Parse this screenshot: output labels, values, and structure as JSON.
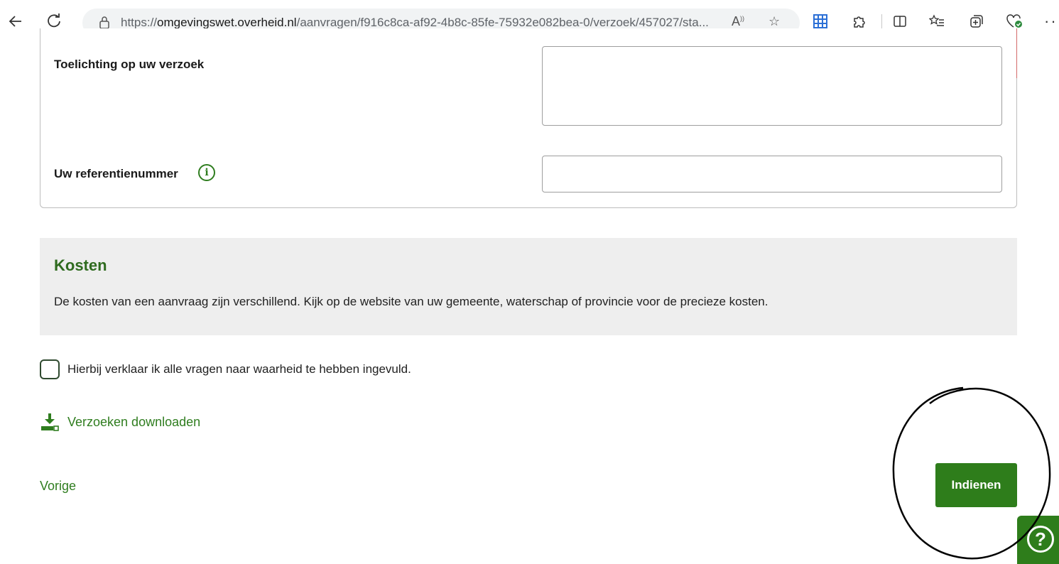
{
  "browser": {
    "url_prefix": "https://",
    "url_domain": "omgevingswet.overheid.nl",
    "url_path": "/aanvragen/f916c8ca-af92-4b8c-85fe-75932e082bea-0/verzoek/457027/sta...",
    "icons": [
      "back-arrow-icon",
      "refresh-icon",
      "lock-icon",
      "read-aloud-icon",
      "favorite-star-icon",
      "app-grid-icon",
      "extensions-icon",
      "split-screen-icon",
      "favorites-list-icon",
      "collections-icon",
      "browser-essentials-icon",
      "more-icon"
    ]
  },
  "form": {
    "toelichting_label": "Toelichting op uw verzoek",
    "toelichting_value": "",
    "referentie_label": "Uw referentienummer",
    "referentie_value": ""
  },
  "kosten": {
    "title": "Kosten",
    "text": "De kosten van een aanvraag zijn verschillend. Kijk op de website van uw gemeente, waterschap of provincie voor de precieze kosten."
  },
  "declaration": {
    "label": "Hierbij verklaar ik alle vragen naar waarheid te hebben ingevuld.",
    "checked": false
  },
  "actions": {
    "download_label": "Verzoeken downloaden",
    "previous_label": "Vorige",
    "submit_label": "Indienen",
    "help_label": "?"
  },
  "colors": {
    "primary_green": "#2e7d1b",
    "link_green": "#2f7d1f",
    "kosten_bg": "#eeeeee"
  }
}
